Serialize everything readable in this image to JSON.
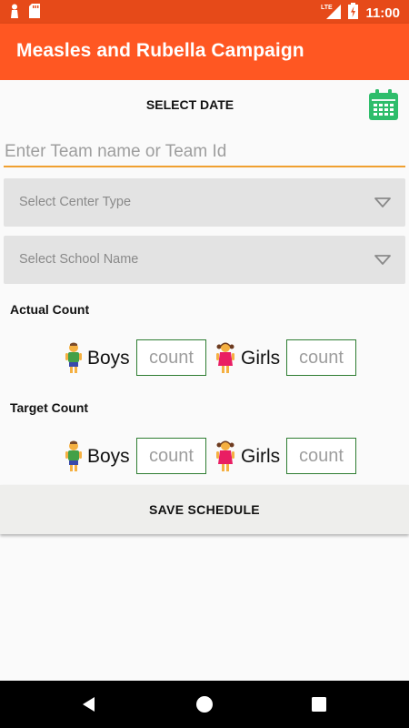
{
  "status_bar": {
    "time": "11:00",
    "network": "LTE",
    "icons": [
      "notification-icon",
      "sd-card-icon",
      "lte-signal-icon",
      "battery-charging-icon"
    ]
  },
  "app_bar": {
    "title": "Measles and Rubella Campaign"
  },
  "form": {
    "select_date_label": "SELECT DATE",
    "calendar_icon": "calendar-icon",
    "team_input_placeholder": "Enter Team name or Team Id",
    "center_type_label": "Select Center Type",
    "school_name_label": "Select School Name",
    "actual_count": {
      "label": "Actual Count",
      "boys_label": "Boys",
      "boys_placeholder": "count",
      "girls_label": "Girls",
      "girls_placeholder": "count"
    },
    "target_count": {
      "label": "Target Count",
      "boys_label": "Boys",
      "boys_placeholder": "count",
      "girls_label": "Girls",
      "girls_placeholder": "count"
    },
    "save_button": "SAVE SCHEDULE"
  },
  "colors": {
    "status_bar": "#e64a19",
    "app_bar": "#ff5722",
    "input_underline": "#f0a030",
    "count_border": "#2e7d32",
    "calendar": "#2ebd6b"
  },
  "nav_bar": {
    "icons": [
      "back-icon",
      "home-icon",
      "recents-icon"
    ]
  }
}
